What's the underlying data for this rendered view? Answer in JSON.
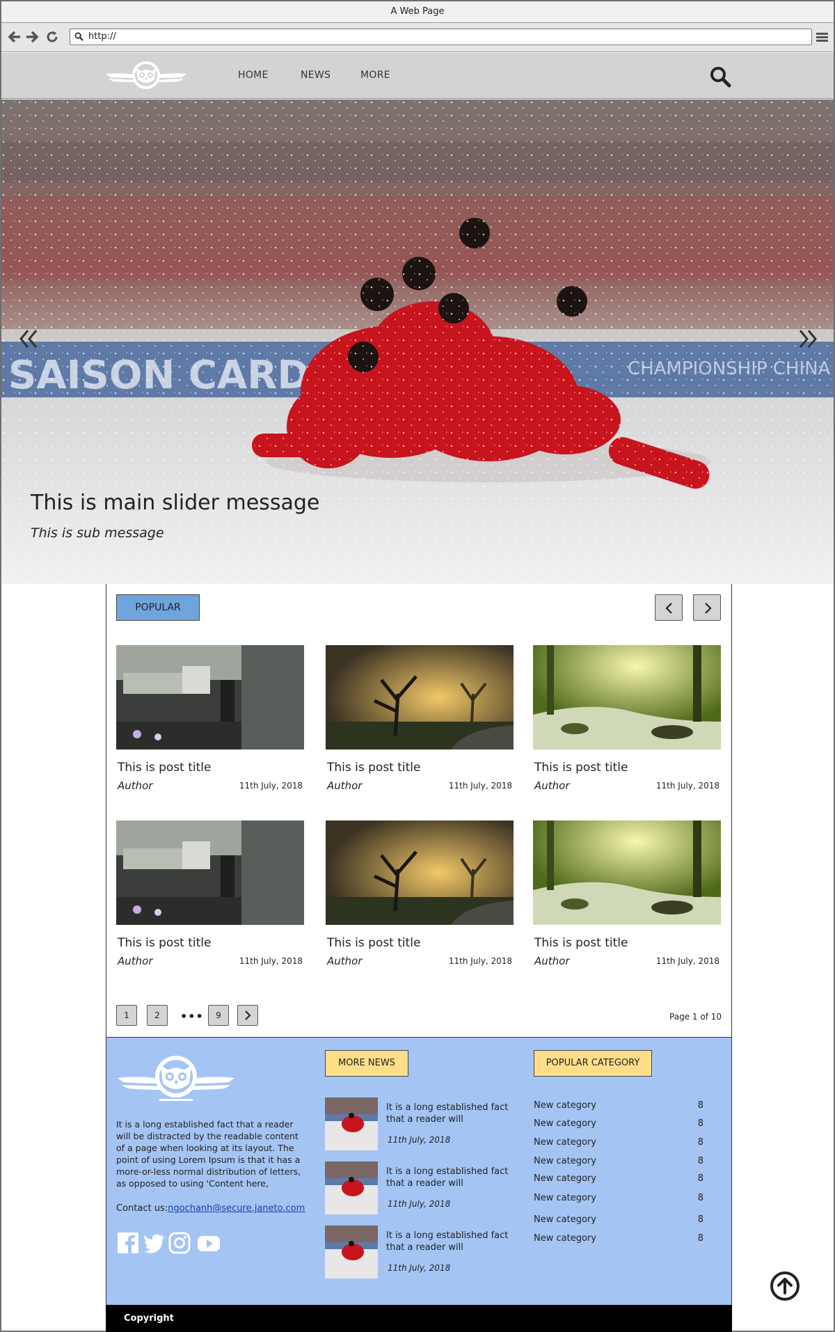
{
  "browser": {
    "title": "A Web Page",
    "url": "http://"
  },
  "header": {
    "menu": [
      "HOME",
      "NEWS",
      "MORE"
    ]
  },
  "hero": {
    "title": "This is main slider message",
    "subtitle": "This is sub message"
  },
  "popular": {
    "tab_label": "POPULAR",
    "posts": [
      {
        "title": "This is post title",
        "author": "Author",
        "date": "11th July, 2018",
        "image": "city-warrior"
      },
      {
        "title": "This is post title",
        "author": "Author",
        "date": "11th July, 2018",
        "image": "foggy-trees"
      },
      {
        "title": "This is post title",
        "author": "Author",
        "date": "11th July, 2018",
        "image": "forest-stream"
      },
      {
        "title": "This is post title",
        "author": "Author",
        "date": "11th July, 2018",
        "image": "city-warrior"
      },
      {
        "title": "This is post title",
        "author": "Author",
        "date": "11th July, 2018",
        "image": "foggy-trees"
      },
      {
        "title": "This is post title",
        "author": "Author",
        "date": "11th July, 2018",
        "image": "forest-stream"
      }
    ],
    "pagination": {
      "pages": [
        "1",
        "2",
        "9"
      ],
      "ellipsis": "•••",
      "info": "Page 1 of 10"
    }
  },
  "footer": {
    "about": "It is a long established fact that a reader will be distracted by the readable content of a page when looking at its layout. The point of using Lorem Ipsum is that it has a more-or-less normal distribution of letters, as opposed to using 'Content here, content here'.",
    "contact_label": "Contact us:",
    "contact_email": "ngochanh@secure.janeto.com",
    "more_news_label": "MORE NEWS",
    "news": [
      {
        "text": "It is a long established fact that a reader will",
        "date": "11th July, 2018"
      },
      {
        "text": "It is a long established fact that a reader will",
        "date": "11th July, 2018"
      },
      {
        "text": "It is a long established fact that a reader will",
        "date": "11th July, 2018"
      }
    ],
    "popular_category_label": "POPULAR CATEGORY",
    "categories": [
      {
        "name": "New category",
        "count": "8"
      },
      {
        "name": "New category",
        "count": "8"
      },
      {
        "name": "New category",
        "count": "8"
      },
      {
        "name": "New category",
        "count": "8"
      },
      {
        "name": "New category",
        "count": "8"
      },
      {
        "name": "New category",
        "count": "8"
      },
      {
        "name": "New category",
        "count": "8"
      },
      {
        "name": "New category",
        "count": "8"
      }
    ],
    "social": [
      "facebook-icon",
      "twitter-icon",
      "instagram-icon",
      "youtube-icon"
    ],
    "copyright": "Copyright"
  },
  "colors": {
    "popular_tab": "#6fa4dd",
    "footer_bg": "#a4c4f4",
    "footer_tags": "#ffde8a",
    "header_bg": "#d3d3d3"
  }
}
